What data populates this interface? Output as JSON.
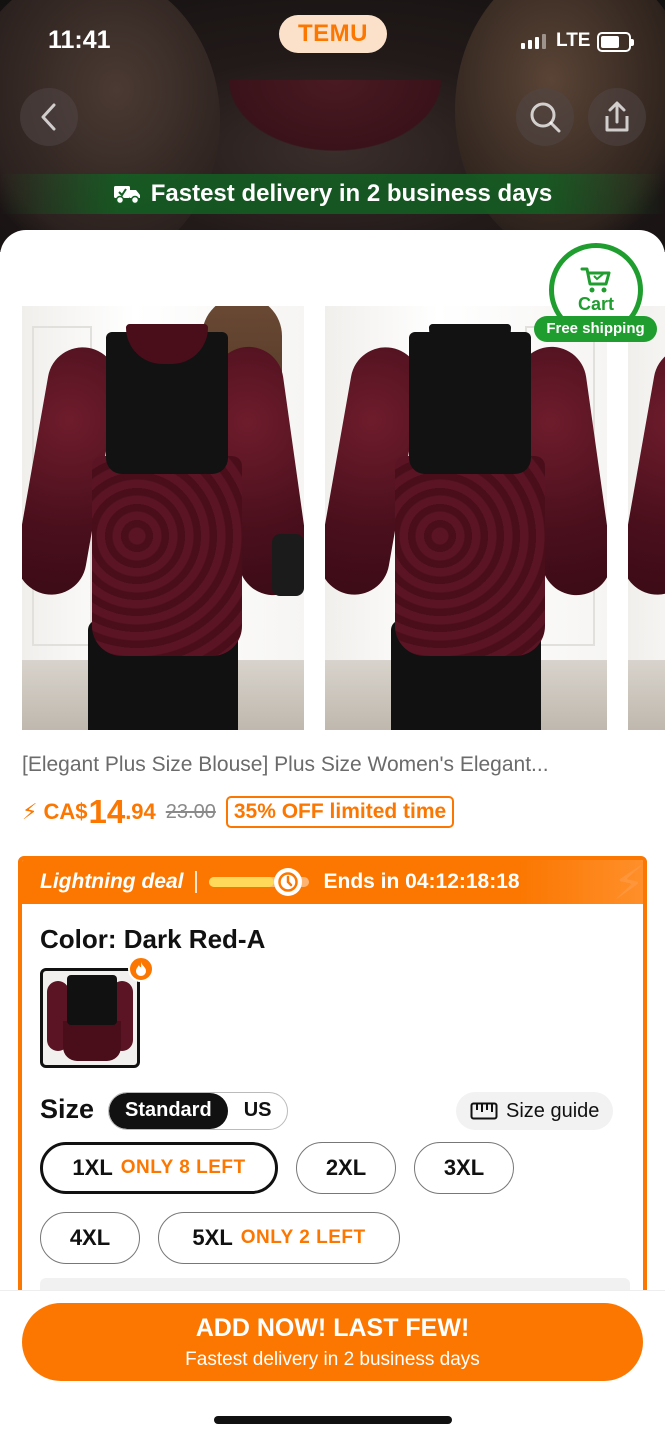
{
  "status_bar": {
    "time": "11:41",
    "brand": "TEMU",
    "network": "LTE"
  },
  "header": {
    "back_icon": "chevron-left-icon",
    "search_icon": "search-icon",
    "share_icon": "share-icon",
    "delivery_banner": "Fastest delivery in 2 business days",
    "delivery_icon": "truck-icon"
  },
  "cart": {
    "label": "Cart",
    "badge": "Free shipping",
    "color": "#1f9d2e"
  },
  "product": {
    "title": "[Elegant Plus Size Blouse] Plus Size Women's Elegant...",
    "currency": "CA$",
    "price_main": "14",
    "price_cents": ".94",
    "old_price": "23.00",
    "discount": "35% OFF limited time"
  },
  "deal": {
    "label": "Lightning deal",
    "ends_in": "Ends in 04:12:18:18",
    "progress": 0.65,
    "accent": "#fb7701"
  },
  "options": {
    "color_label": "Color: Dark Red-A",
    "size_label": "Size",
    "size_systems": [
      "Standard",
      "US"
    ],
    "selected_system": "Standard",
    "size_guide": "Size guide",
    "sizes": [
      {
        "name": "1XL",
        "note": "ONLY 8 LEFT",
        "selected": true
      },
      {
        "name": "2XL",
        "note": ""
      },
      {
        "name": "3XL",
        "note": ""
      },
      {
        "name": "4XL",
        "note": ""
      },
      {
        "name": "5XL",
        "note": "ONLY 2 LEFT"
      }
    ]
  },
  "cta": {
    "line1": "ADD NOW! LAST FEW!",
    "line2": "Fastest delivery in 2 business days"
  }
}
